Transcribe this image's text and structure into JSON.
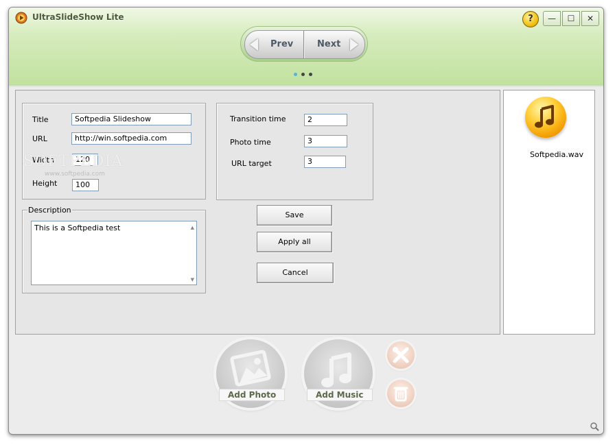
{
  "window": {
    "title": "UltraSlideShow Lite"
  },
  "titlebar": {
    "help_glyph": "?",
    "min_glyph": "—",
    "max_glyph": "☐",
    "close_glyph": "✕"
  },
  "nav": {
    "prev_label": "Prev",
    "next_label": "Next",
    "page_dots": 3,
    "active_dot": 1
  },
  "form": {
    "title_label": "Title",
    "title_value": "Softpedia Slideshow",
    "url_label": "URL",
    "url_value": "http://win.softpedia.com",
    "width_label": "Width",
    "width_value": "120",
    "height_label": "Height",
    "height_value": "100",
    "transition_label": "Transition time",
    "transition_value": "2",
    "photo_time_label": "Photo time",
    "photo_time_value": "3",
    "url_target_label": "URL target",
    "url_target_value": "3",
    "description_label": "Description",
    "description_value": "This is a Softpedia test"
  },
  "actions": {
    "save_label": "Save",
    "apply_all_label": "Apply all",
    "cancel_label": "Cancel"
  },
  "media": {
    "file_name": "Softpedia.wav",
    "file_icon": "music-note-icon"
  },
  "bottom": {
    "add_photo_label": "Add Photo",
    "add_music_label": "Add Music",
    "tools_icon": "tools-icon",
    "trash_icon": "trash-icon"
  },
  "watermark": {
    "text": "SOFTPEDIA",
    "sub": "www.softpedia.com"
  },
  "colors": {
    "header_green": "#c2e2a0",
    "panel_bg": "#e6e6e6",
    "accent_dot": "#5ab0d8"
  }
}
